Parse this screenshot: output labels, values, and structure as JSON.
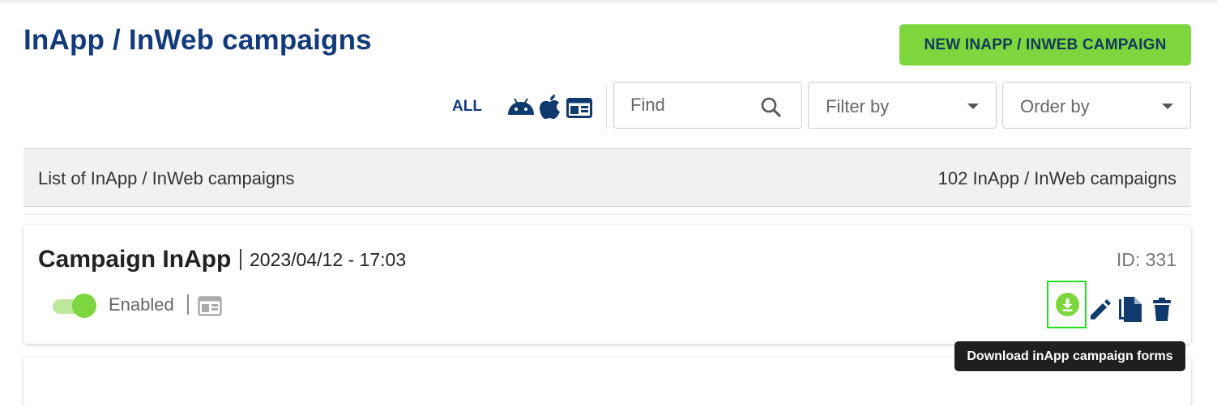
{
  "header": {
    "title": "InApp / InWeb campaigns",
    "new_button_label": "NEW INAPP / INWEB CAMPAIGN"
  },
  "filters": {
    "platform_all_label": "ALL",
    "platform_icons": [
      "android-icon",
      "apple-icon",
      "web-window-icon"
    ],
    "search_placeholder": "Find",
    "filter_by_label": "Filter by",
    "order_by_label": "Order by"
  },
  "list": {
    "title": "List of InApp / InWeb campaigns",
    "count_label": "102 InApp / InWeb campaigns"
  },
  "campaigns": [
    {
      "name": "Campaign InApp",
      "date": "2023/04/12 - 17:03",
      "id_label": "ID: 331",
      "status": "Enabled",
      "enabled": true,
      "platform_icon": "web-window-icon",
      "actions": [
        "download-icon",
        "edit-pencil-icon",
        "copy-icon",
        "trash-icon"
      ]
    }
  ],
  "tooltip": {
    "text": "Download inApp campaign forms"
  },
  "colors": {
    "brand_blue": "#123a7c",
    "accent_green": "#7ed63e",
    "highlight_green": "#22e01e",
    "icon_navy": "#0f3a6e"
  }
}
